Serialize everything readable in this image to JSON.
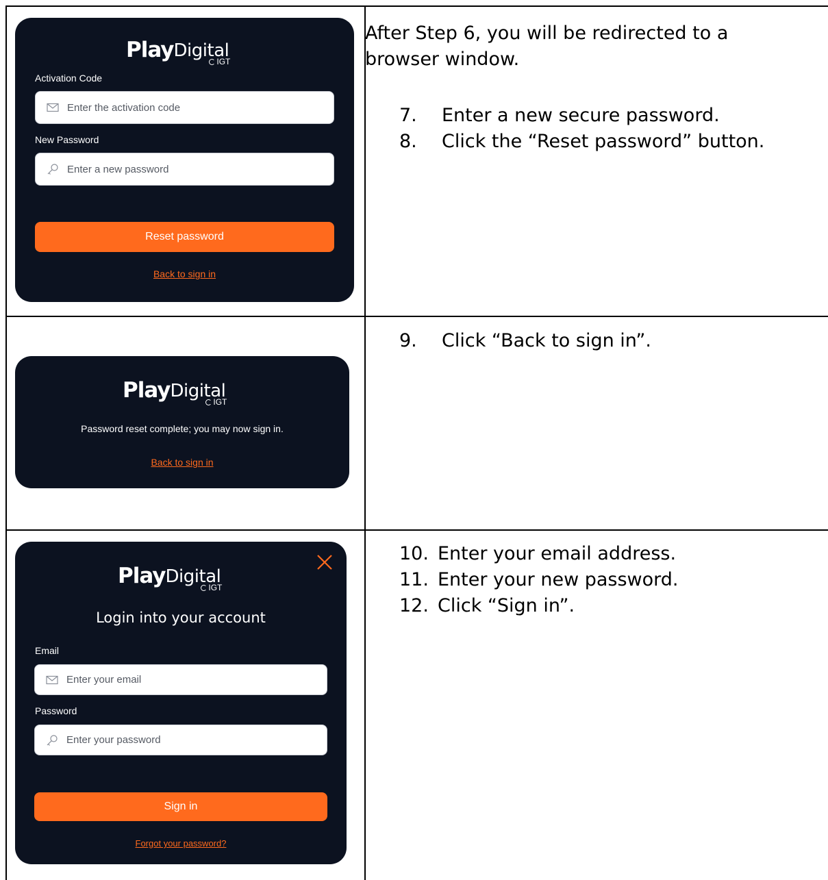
{
  "row1": {
    "intro": "After Step 6, you will be redirected to a browser window.",
    "steps": [
      {
        "num": "7.",
        "text": "Enter a new secure password."
      },
      {
        "num": "8.",
        "text": "Click the “Reset password” button."
      }
    ],
    "panel": {
      "logo_play": "Play",
      "logo_digital": "Digital",
      "logo_igt": "IGT",
      "activation_label": "Activation Code",
      "activation_placeholder": "Enter the activation code",
      "password_label": "New Password",
      "password_placeholder": "Enter a new password",
      "reset_button": "Reset password",
      "back_link": "Back to sign in"
    }
  },
  "row2": {
    "steps": [
      {
        "num": "9.",
        "text": "Click “Back to sign in”."
      }
    ],
    "panel": {
      "logo_play": "Play",
      "logo_digital": "Digital",
      "logo_igt": "IGT",
      "message": "Password reset complete; you may now sign in.",
      "back_link": "Back to sign in"
    }
  },
  "row3": {
    "steps": [
      {
        "num": "10.",
        "text": "Enter your email address."
      },
      {
        "num": "11.",
        "text": "Enter your new password."
      },
      {
        "num": "12.",
        "text": "Click “Sign in”."
      }
    ],
    "panel": {
      "logo_play": "Play",
      "logo_digital": "Digital",
      "logo_igt": "IGT",
      "heading": "Login into your account",
      "email_label": "Email",
      "email_placeholder": "Enter your email",
      "password_label": "Password",
      "password_placeholder": "Enter your password",
      "signin_button": "Sign in",
      "forgot_link": "Forgot your password?"
    }
  },
  "colors": {
    "panel_bg": "#0c1220",
    "accent": "#ff6a1d",
    "border": "#000000"
  },
  "icons": {
    "close": "close-icon",
    "mail": "mail-icon",
    "key": "key-icon"
  }
}
